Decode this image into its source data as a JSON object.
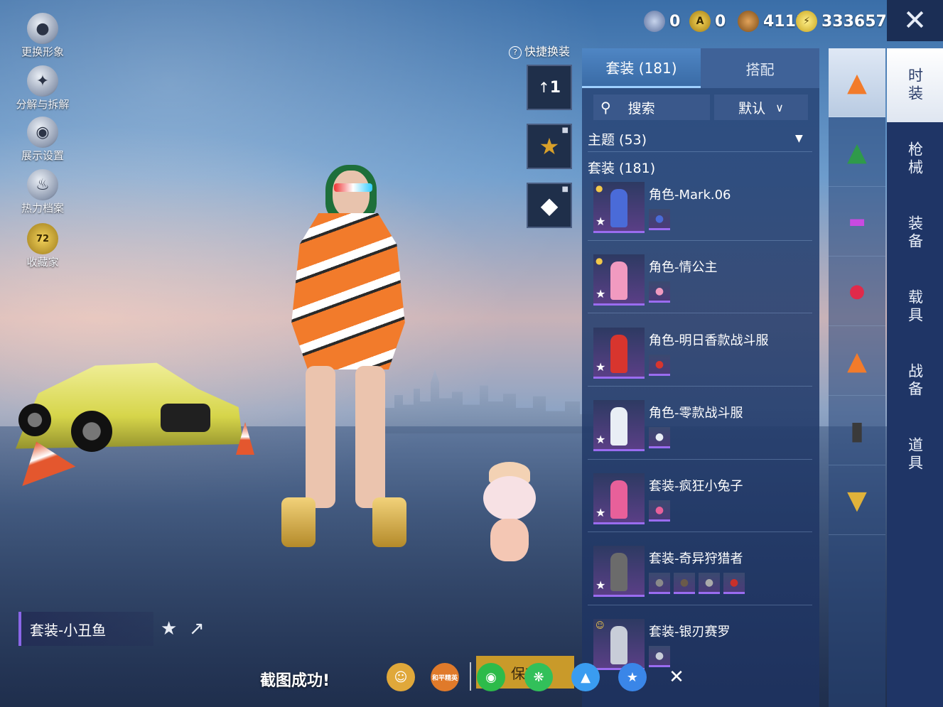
{
  "left_menu": [
    {
      "label": "更换形象",
      "icon": "person-icon"
    },
    {
      "label": "分解与拆解",
      "icon": "puzzle-icon"
    },
    {
      "label": "展示设置",
      "icon": "eye-icon"
    },
    {
      "label": "热力档案",
      "icon": "flame-icon"
    },
    {
      "label": "收藏家",
      "icon": "collector-badge-icon",
      "badge": "72"
    }
  ],
  "currencies": [
    {
      "value": "0",
      "color": "#8aa0c8",
      "icon": "blue-coin-icon"
    },
    {
      "value": "0",
      "color": "#e0b23a",
      "icon": "gold-a-coin-icon"
    },
    {
      "value": "4111",
      "color": "#c98a3a",
      "icon": "bronze-coin-icon"
    },
    {
      "value": "333657",
      "color": "#e8d04a",
      "icon": "lightning-coin-icon"
    }
  ],
  "quick_change": {
    "label": "快捷换装",
    "icon": "question-icon"
  },
  "tool_buttons": [
    {
      "icon": "hanger-icon",
      "badge": "1"
    },
    {
      "icon": "trophy-badge-icon",
      "locked": true
    },
    {
      "icon": "diamond-icon",
      "locked": true
    }
  ],
  "tabs": [
    {
      "label": "套装 (181)",
      "active": true
    },
    {
      "label": "搭配",
      "active": false
    }
  ],
  "search": {
    "placeholder": "搜索",
    "sort": "默认"
  },
  "sections": {
    "theme": "主题 (53)",
    "suits": "套装 (181)"
  },
  "items": [
    {
      "name": "角色-Mark.06",
      "color": "#4a6bd8",
      "subs": 1,
      "badge": true
    },
    {
      "name": "角色-情公主",
      "color": "#f19ac0",
      "subs": 1,
      "badge": true
    },
    {
      "name": "角色-明日香款战斗服",
      "color": "#d8352e",
      "subs": 1,
      "badge": false
    },
    {
      "name": "角色-零款战斗服",
      "color": "#e9eef5",
      "subs": 1,
      "badge": false
    },
    {
      "name": "套装-疯狂小兔子",
      "color": "#e8609a",
      "subs": 1,
      "badge": false
    },
    {
      "name": "套装-奇异狩猎者",
      "color": "#6b6b6b",
      "subs": 4,
      "badge": false
    },
    {
      "name": "套装-银刃赛罗",
      "color": "#c8cdd8",
      "subs": 1,
      "badge": true
    }
  ],
  "categories": [
    {
      "icon": "orange-outfit-icon",
      "active": true
    },
    {
      "icon": "green-hood-icon",
      "active": false
    },
    {
      "icon": "visor-icon",
      "active": false
    },
    {
      "icon": "red-nose-icon",
      "active": false
    },
    {
      "icon": "orange-outfit-icon",
      "active": false
    },
    {
      "icon": "pants-icon",
      "active": false
    },
    {
      "icon": "gold-shoes-icon",
      "active": false
    }
  ],
  "right_nav": [
    {
      "label": "时装",
      "active": true
    },
    {
      "label": "枪械",
      "active": false
    },
    {
      "label": "装备",
      "active": false
    },
    {
      "label": "载具",
      "active": false
    },
    {
      "label": "战备",
      "active": false
    },
    {
      "label": "道具",
      "active": false
    }
  ],
  "current_outfit": "套装-小丑鱼",
  "bottom": {
    "screenshot_ok": "截图成功!",
    "save_label": "保存",
    "share_targets": [
      {
        "icon": "avatar-share-icon",
        "color": "#e0a83a"
      },
      {
        "icon": "peace-elite-icon",
        "color": "#e07a2a",
        "text": "和平精英"
      },
      {
        "icon": "wechat-icon",
        "color": "#2dbb4a"
      },
      {
        "icon": "moments-icon",
        "color": "#32c05a"
      },
      {
        "icon": "qq-icon",
        "color": "#3a9cf0"
      },
      {
        "icon": "qzone-icon",
        "color": "#3a86e8"
      }
    ]
  }
}
